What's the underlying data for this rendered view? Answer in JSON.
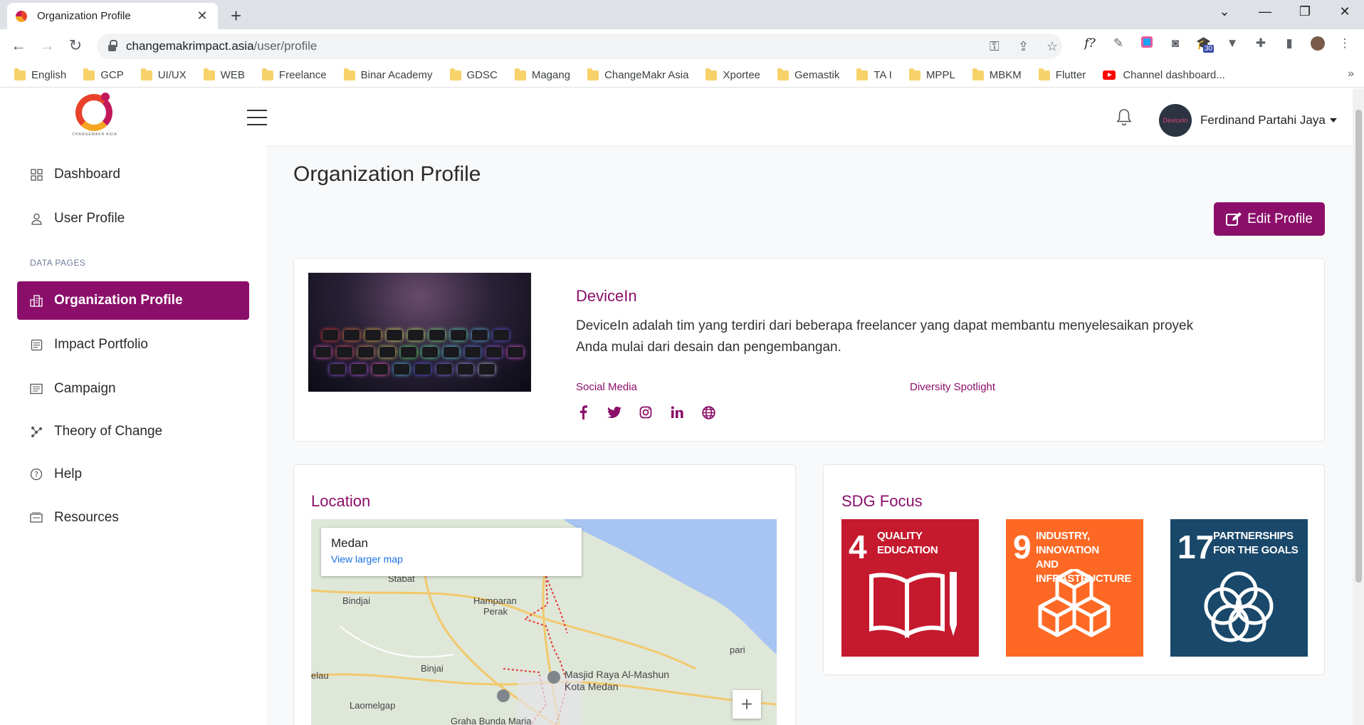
{
  "browser": {
    "tab_title": "Organization Profile",
    "tab_close": "✕",
    "new_tab": "+",
    "url_host": "changemakrimpact.asia",
    "url_path": "/user/profile",
    "bookmarks": [
      "English",
      "GCP",
      "UI/UX",
      "WEB",
      "Freelance",
      "Binar Academy",
      "GDSC",
      "Magang",
      "ChangeMakr Asia",
      "Xportee",
      "Gemastik",
      "TA I",
      "MPPL",
      "MBKM",
      "Flutter"
    ],
    "youtube_bookmark": "Channel dashboard...",
    "ext_badge": "30",
    "ext_font_label": "f?"
  },
  "header": {
    "logo_text": "CHANGEMAKR ASIA",
    "user_name": "Ferdinand Partahi Jaya",
    "avatar_text": "DeviceIn"
  },
  "sidebar": {
    "items": [
      {
        "label": "Dashboard",
        "icon": "grid-icon"
      },
      {
        "label": "User Profile",
        "icon": "user-icon"
      },
      {
        "label": "Organization Profile",
        "icon": "building-icon"
      },
      {
        "label": "Impact Portfolio",
        "icon": "portfolio-icon"
      },
      {
        "label": "Campaign",
        "icon": "campaign-icon"
      },
      {
        "label": "Theory of Change",
        "icon": "nodes-icon"
      },
      {
        "label": "Help",
        "icon": "help-icon"
      },
      {
        "label": "Resources",
        "icon": "resources-icon"
      }
    ],
    "section_label": "DATA PAGES",
    "active_item": "Organization Profile"
  },
  "main": {
    "page_title": "Organization Profile",
    "edit_button": "Edit Profile",
    "org": {
      "name": "DeviceIn",
      "description": "DeviceIn adalah tim yang terdiri dari beberapa freelancer yang dapat membantu menyelesaikan proyek Anda mulai dari desain dan pengembangan.",
      "social_label": "Social Media",
      "diversity_label": "Diversity Spotlight",
      "social_icons": [
        "facebook-icon",
        "twitter-icon",
        "instagram-icon",
        "linkedin-icon",
        "globe-icon"
      ]
    },
    "location": {
      "title": "Location",
      "city": "Medan",
      "map_link": "View larger map",
      "zoom_in": "+",
      "places": [
        "Stabat",
        "Bindjai",
        "Hamparan",
        "Perak",
        "pari",
        "Binjai",
        "elau",
        "Masjid Raya Al-Mashun",
        "Kota Medan",
        "Laomelgap",
        "Graha Bunda Maria"
      ]
    },
    "sdg": {
      "title": "SDG Focus",
      "goals": [
        {
          "number": "4",
          "line1": "QUALITY",
          "line2": "EDUCATION",
          "color": "#c5192d"
        },
        {
          "number": "9",
          "line1": "INDUSTRY, INNOVATION",
          "line2": "AND INFRASTRUCTURE",
          "color": "#fd6925"
        },
        {
          "number": "17",
          "line1": "PARTNERSHIPS",
          "line2": "FOR THE GOALS",
          "color": "#19486a"
        }
      ]
    }
  },
  "colors": {
    "brand": "#8b0f6a",
    "sdg4": "#c5192d",
    "sdg9": "#fd6925",
    "sdg17": "#19486a"
  }
}
